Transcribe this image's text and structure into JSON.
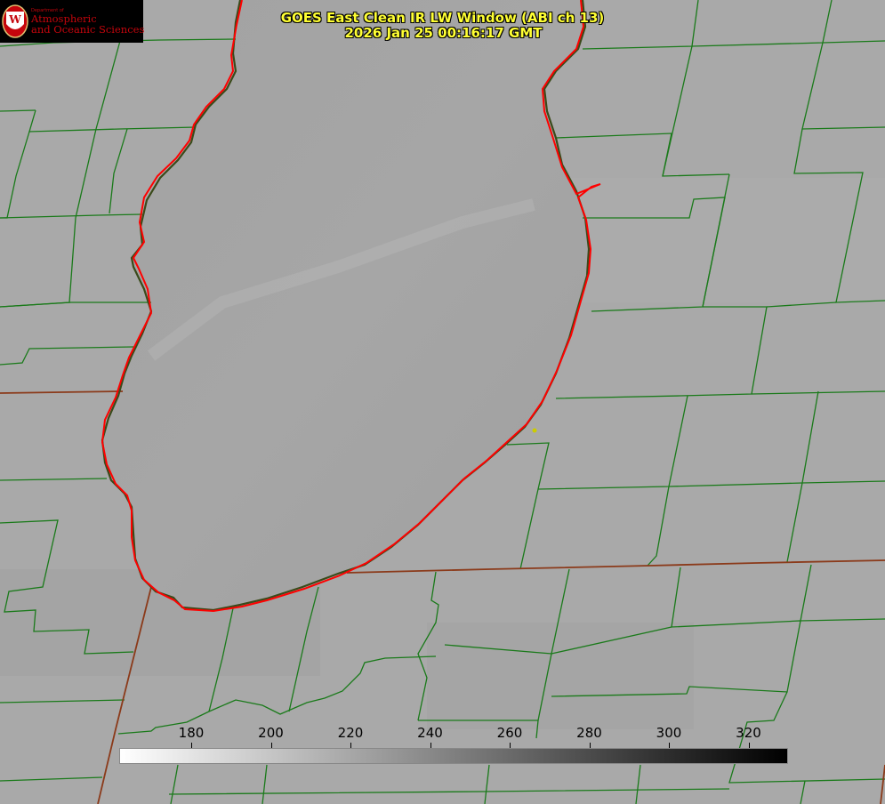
{
  "logo": {
    "dept": "Department of",
    "line1": "Atmospheric",
    "line2": "and Oceanic Sciences",
    "seal_letter": "W"
  },
  "title": {
    "line1": "GOES East Clean IR LW Window (ABI ch 13)",
    "line2": "2026 Jan 25 00:16:17 GMT"
  },
  "colorbar": {
    "ticks": [
      "180",
      "200",
      "220",
      "240",
      "260",
      "280",
      "300",
      "320"
    ],
    "gradient_start": "#ffffff",
    "gradient_end": "#000000"
  },
  "colors": {
    "background": "#a9a9a9",
    "county_lines": "#1a7a1a",
    "state_lines": "#8b3a1a",
    "coastline": "#ff0000",
    "title_text": "#ffff33",
    "marker": "#cccc00"
  }
}
